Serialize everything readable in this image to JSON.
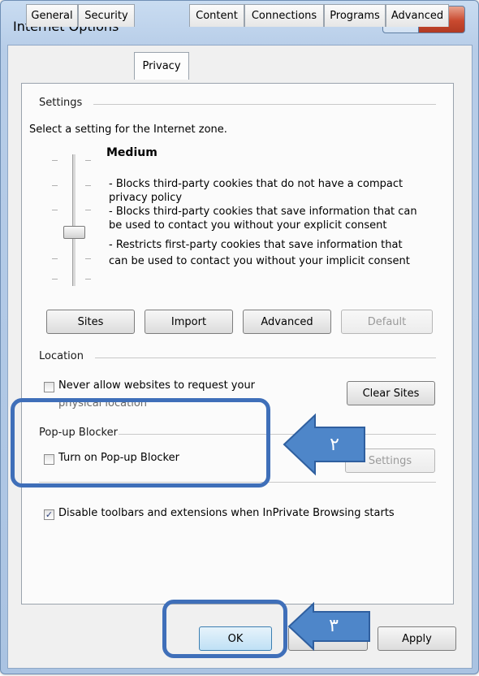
{
  "window": {
    "title": "Internet Options",
    "help_glyph": "?",
    "close_glyph": "X"
  },
  "tabs": [
    "General",
    "Security",
    "Privacy",
    "Content",
    "Connections",
    "Programs",
    "Advanced"
  ],
  "settings": {
    "group_title": "Settings",
    "intro": "Select a setting for the Internet zone.",
    "level": "Medium",
    "desc": [
      "- Blocks third-party cookies that do not have a compact",
      "privacy policy",
      "- Blocks third-party cookies that save information that can",
      "be used to contact you without your explicit consent",
      "- Restricts first-party cookies that save information that",
      "can be used to contact you without your implicit consent"
    ],
    "slider_level_fraction": 0.5,
    "buttons": {
      "sites": "Sites",
      "import": "Import",
      "advanced": "Advanced",
      "default": "Default"
    }
  },
  "location": {
    "group_title": "Location",
    "never_allow": "Never allow websites to request your",
    "never_allow_2": "physical location",
    "clear_sites": "Clear Sites"
  },
  "popup": {
    "group_title": "Pop-up Blocker",
    "turn_on": "Turn on Pop-up Blocker",
    "settings_btn": "Settings"
  },
  "inprivate": {
    "disable_toolbars": "Disable toolbars and extensions when InPrivate Browsing starts"
  },
  "footer": {
    "ok": "OK",
    "cancel": "Cancel",
    "apply": "Apply"
  },
  "annotations": {
    "step_2": "٢",
    "step_3": "٣",
    "accent": "#3f6fb9"
  }
}
